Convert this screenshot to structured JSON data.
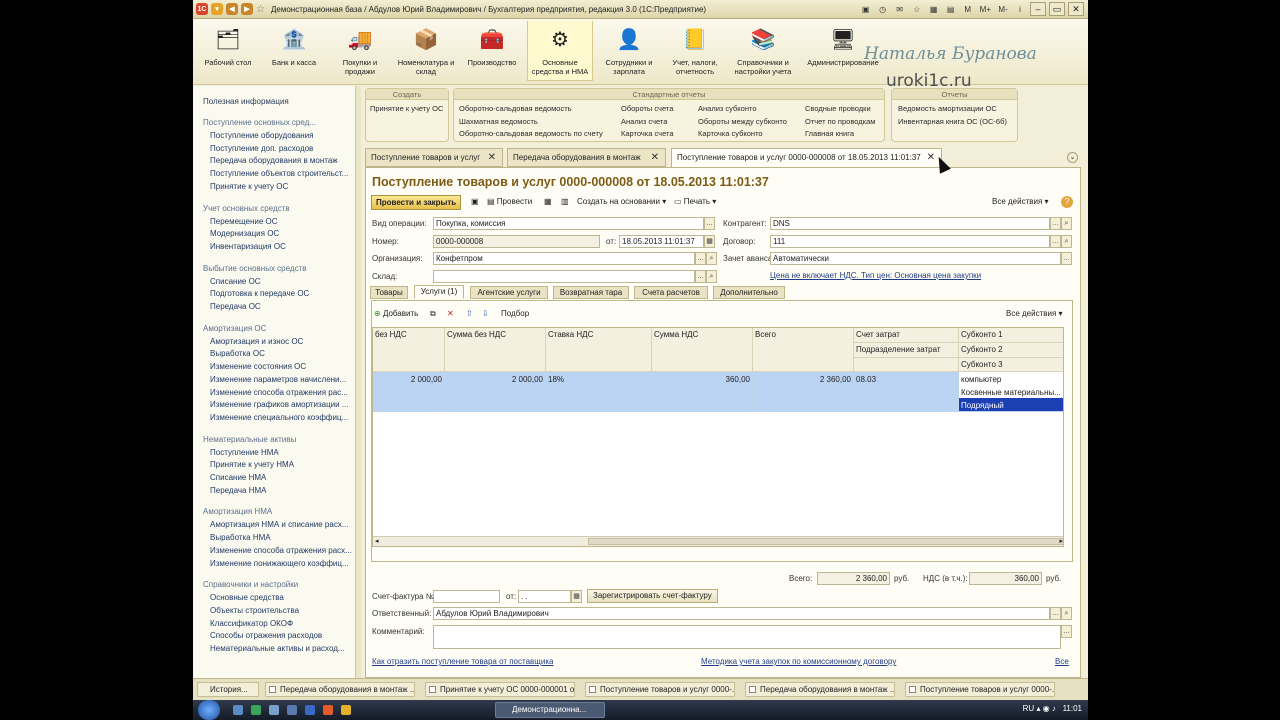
{
  "window": {
    "title": "Демонстрационная база / Абдулов Юрий Владимирович / Бухгалтерия предприятия, редакция 3.0  (1С:Предприятие)",
    "buttons": [
      "M",
      "M+",
      "M-",
      "i"
    ]
  },
  "sections": [
    {
      "label": "Рабочий стол",
      "icon": "desk-icon"
    },
    {
      "label": "Банк и касса",
      "icon": "bank-icon"
    },
    {
      "label": "Покупки и продажи",
      "icon": "cart-icon"
    },
    {
      "label": "Номенклатура и склад",
      "icon": "warehouse-icon"
    },
    {
      "label": "Производство",
      "icon": "production-icon"
    },
    {
      "label": "Основные средства и НМА",
      "icon": "assets-icon"
    },
    {
      "label": "Сотрудники и зарплата",
      "icon": "employee-icon"
    },
    {
      "label": "Учет, налоги, отчетность",
      "icon": "reports-icon"
    },
    {
      "label": "Справочники и настройки учета",
      "icon": "books-icon"
    },
    {
      "label": "Администрирование",
      "icon": "admin-icon"
    }
  ],
  "watermark": {
    "author": "Наталья Буранова",
    "site": "uroki1c.ru"
  },
  "sidebar": {
    "useful": "Полезная информация",
    "groups": [
      {
        "title": "Поступление основных сред...",
        "items": [
          "Поступление оборудования",
          "Поступление доп. расходов",
          "Передача оборудования в монтаж",
          "Поступление объектов строительст...",
          "Принятие к учету ОС"
        ]
      },
      {
        "title": "Учет основных средств",
        "items": [
          "Перемещение ОС",
          "Модернизация ОС",
          "Инвентаризация ОС"
        ]
      },
      {
        "title": "Выбытие основных средств",
        "items": [
          "Списание ОС",
          "Подготовка к передаче ОС",
          "Передача ОС"
        ]
      },
      {
        "title": "Амортизация ОС",
        "items": [
          "Амортизация и износ ОС",
          "Выработка ОС",
          "Изменение состояния ОС",
          "Изменение параметров начислени...",
          "Изменение способа отражения рас...",
          "Изменение графиков амортизации ...",
          "Изменение специального коэффиц..."
        ]
      },
      {
        "title": "Нематериальные активы",
        "items": [
          "Поступление НМА",
          "Принятие к учету НМА",
          "Списание НМА",
          "Передача НМА"
        ]
      },
      {
        "title": "Амортизация НМА",
        "items": [
          "Амортизация НМА и списание расх...",
          "Выработка НМА",
          "Изменение способа отражения расх...",
          "Изменение понижающего коэффиц..."
        ]
      },
      {
        "title": "Справочники и настройки",
        "items": [
          "Основные средства",
          "Объекты строительства",
          "Классификатор ОКОФ",
          "Способы отражения расходов",
          "Нематериальные активы и расход..."
        ]
      }
    ]
  },
  "actions": {
    "create": {
      "title": "Создать",
      "items": [
        "Принятие к учету ОС"
      ]
    },
    "standard": {
      "title": "Стандартные отчеты",
      "items": [
        "Оборотно-сальдовая ведомость",
        "Шахматная ведомость",
        "Оборотно-сальдовая ведомость по счету",
        "Обороты счета",
        "Анализ счета",
        "Карточка счета",
        "Анализ субконто",
        "Обороты между субконто",
        "Карточка субконто",
        "Сводные проводки",
        "Отчет по проводкам",
        "Главная книга"
      ]
    },
    "reports": {
      "title": "Отчеты",
      "items": [
        "Ведомость амортизации ОС",
        "Инвентарная книга ОС (ОС-6б)"
      ]
    }
  },
  "doc_tabs": [
    {
      "label": "Поступление товаров и услуг"
    },
    {
      "label": "Передача оборудования в монтаж"
    },
    {
      "label": "Поступление товаров и услуг 0000-000008 от 18.05.2013 11:01:37"
    }
  ],
  "doc": {
    "title": "Поступление товаров и услуг 0000-000008 от 18.05.2013 11:01:37",
    "toolbar": {
      "post_close": "Провести и закрыть",
      "post": "Провести",
      "create_based": "Создать на основании",
      "print": "Печать",
      "all_actions": "Все действия"
    },
    "fields": {
      "op_label": "Вид операции:",
      "op_value": "Покупка, комиссия",
      "num_label": "Номер:",
      "num_value": "0000-000008",
      "date_label": "от:",
      "date_value": "18.05.2013 11:01:37",
      "org_label": "Организация:",
      "org_value": "Конфетпром",
      "store_label": "Склад:",
      "store_value": "",
      "contractor_label": "Контрагент:",
      "contractor_value": "DNS",
      "contract_label": "Договор:",
      "contract_value": "111",
      "advance_label": "Зачет аванса:",
      "advance_value": "Автоматически",
      "price_link": "Цена не включает НДС. Тип цен: Основная цена закупки"
    },
    "tabs": [
      "Товары",
      "Услуги (1)",
      "Агентские услуги",
      "Возвратная тара",
      "Счета расчетов",
      "Дополнительно"
    ],
    "table_toolbar": {
      "add": "Добавить",
      "pick": "Подбор",
      "all_actions": "Все действия"
    },
    "columns": {
      "vat_partial": "без НДС",
      "sum_no_vat": "Сумма без НДС",
      "vat_rate": "Ставка НДС",
      "vat_sum": "Сумма НДС",
      "total": "Всего",
      "account": "Счет затрат",
      "dept": "Подразделение затрат",
      "sub1": "Субконто 1",
      "sub2": "Субконто 2",
      "sub3": "Субконто 3"
    },
    "row": {
      "vat_partial": "2 000,00",
      "sum_no_vat": "2 000,00",
      "vat_rate": "18%",
      "vat_sum": "360,00",
      "total": "2 360,00",
      "account": "08.03",
      "sub1": "компьютер",
      "sub2": "Косвенные материальны...",
      "sub3": "Подрядный"
    },
    "totals": {
      "total_label": "Всего:",
      "total_value": "2 360,00",
      "cur1": "руб.",
      "vat_label": "НДС (в т.ч.):",
      "vat_value": "360,00",
      "cur2": "руб."
    },
    "invoice": {
      "label": "Счет-фактура №:",
      "date_label": "от:",
      "date_value": ". .",
      "register": "Зарегистрировать счет-фактуру"
    },
    "responsible_label": "Ответственный:",
    "responsible_value": "Абдулов Юрий Владимирович",
    "comment_label": "Комментарий:",
    "link1": "Как отразить поступление товара от поставщика",
    "link2": "Методика учета закупок по комиссионному договору",
    "all": "Все"
  },
  "statusbar": {
    "history": "История...",
    "tasks": [
      "Передача оборудования в монтаж ...",
      "Принятие к учету ОС 0000-000001 о...",
      "Поступление товаров и услуг 0000-...",
      "Передача оборудования в монтаж ...",
      "Поступление товаров и услуг 0000-..."
    ]
  },
  "taskbar": {
    "active": "Демонстрационна...",
    "lang": "RU",
    "time": "11:01"
  }
}
